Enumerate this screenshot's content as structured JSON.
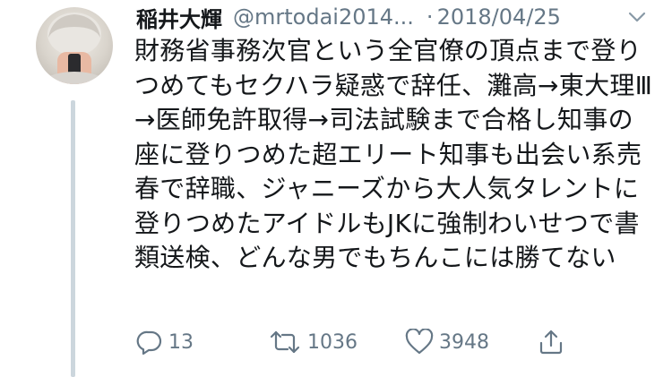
{
  "tweet": {
    "display_name": "稲井大輝",
    "handle": "@mrtodai2014...",
    "separator": "·",
    "date": "2018/04/25",
    "text": "財務省事務次官という全官僚の頂点まで登りつめてもセクハラ疑惑で辞任、灘高→東大理Ⅲ→医師免許取得→司法試験まで合格し知事の座に登りつめた超エリート知事も出会い系売春で辞職、ジャニーズから大人気タレントに登りつめたアイドルもJKに強制わいせつで書類送検、どんな男でもちんこには勝てない"
  },
  "actions": {
    "reply_count": "13",
    "retweet_count": "1036",
    "like_count": "3948"
  },
  "icons": {
    "avatar": "avatar-photo",
    "caret": "chevron-down-icon",
    "reply": "reply-icon",
    "retweet": "retweet-icon",
    "like": "heart-icon",
    "share": "share-icon"
  },
  "colors": {
    "text": "#14171a",
    "secondary": "#657786",
    "thread_line": "#ccd6dd"
  }
}
